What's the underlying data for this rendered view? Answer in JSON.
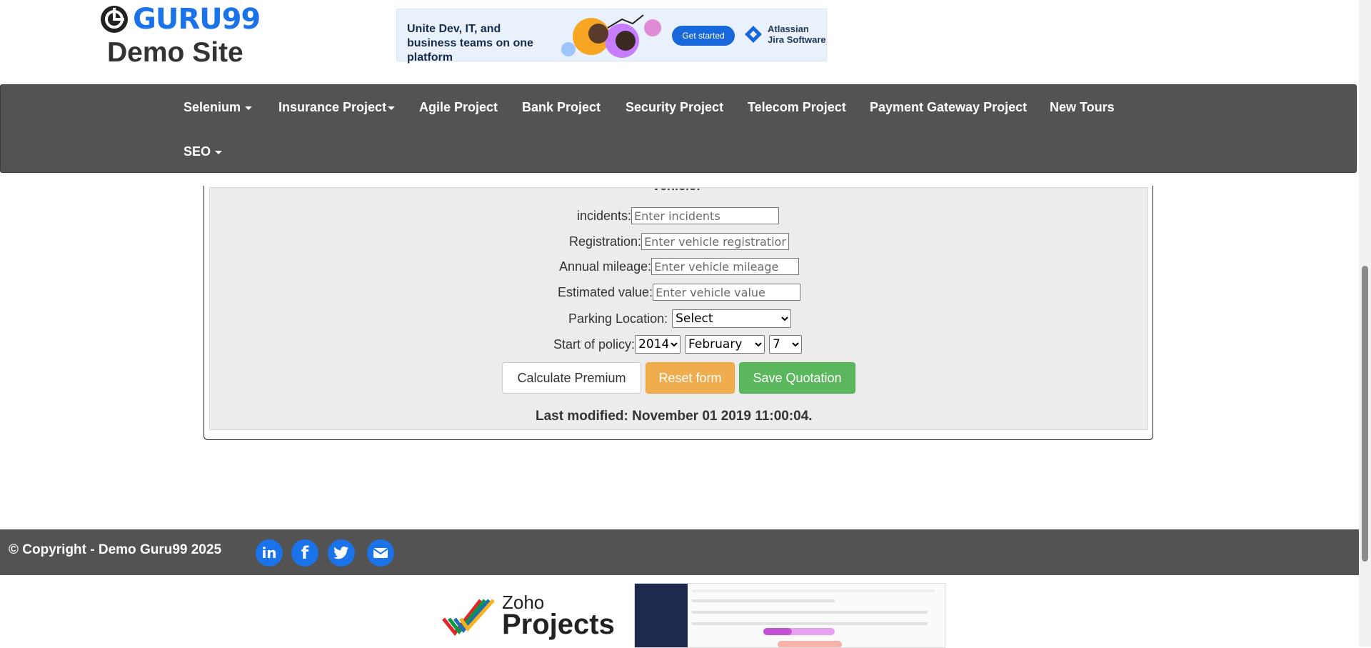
{
  "header": {
    "logo_text": "GURU99",
    "site_name": "Demo Site"
  },
  "ad_banner": {
    "headline": "Unite Dev, IT, and business teams on one platform",
    "cta": "Get started",
    "brand": "Atlassian Jira Software",
    "brand_line1": "Atlassian",
    "brand_line2": "Jira Software"
  },
  "nav": {
    "items": [
      {
        "label": "Selenium",
        "has_caret": true
      },
      {
        "label": "Insurance Project",
        "has_caret": true
      },
      {
        "label": "Agile Project"
      },
      {
        "label": "Bank Project"
      },
      {
        "label": "Security Project"
      },
      {
        "label": "Telecom Project"
      },
      {
        "label": "Payment Gateway Project"
      },
      {
        "label": "New Tours"
      },
      {
        "label": "SEO",
        "has_caret": true
      }
    ]
  },
  "form": {
    "cut_heading": "Vehicle:",
    "incidents": {
      "label": "incidents:",
      "placeholder": "Enter incidents",
      "value": ""
    },
    "registration": {
      "label": "Registration:",
      "placeholder": "Enter vehicle registration",
      "value": ""
    },
    "mileage": {
      "label": "Annual mileage:",
      "placeholder": "Enter vehicle mileage",
      "value": ""
    },
    "estimated_value": {
      "label": "Estimated value:",
      "placeholder": "Enter vehicle value",
      "value": ""
    },
    "parking": {
      "label": "Parking Location:",
      "selected": "Select"
    },
    "start_policy": {
      "label": "Start of policy:",
      "year": "2014",
      "month": "February",
      "day": "7"
    },
    "buttons": {
      "calculate": "Calculate Premium",
      "reset": "Reset form",
      "save": "Save Quotation"
    },
    "last_modified": "Last modified: November 01 2019 11:00:04."
  },
  "footer": {
    "copyright": "© Copyright - Demo Guru99 2025",
    "social": [
      "linkedin-icon",
      "facebook-icon",
      "twitter-icon",
      "email-icon"
    ]
  },
  "bottom_ad": {
    "brand_line1": "Zoho",
    "brand_line2": "Projects"
  },
  "colors": {
    "nav_bg": "#535353",
    "brand_blue": "#1a73e8",
    "btn_warning": "#f0ad4e",
    "btn_success": "#5cb85c"
  }
}
